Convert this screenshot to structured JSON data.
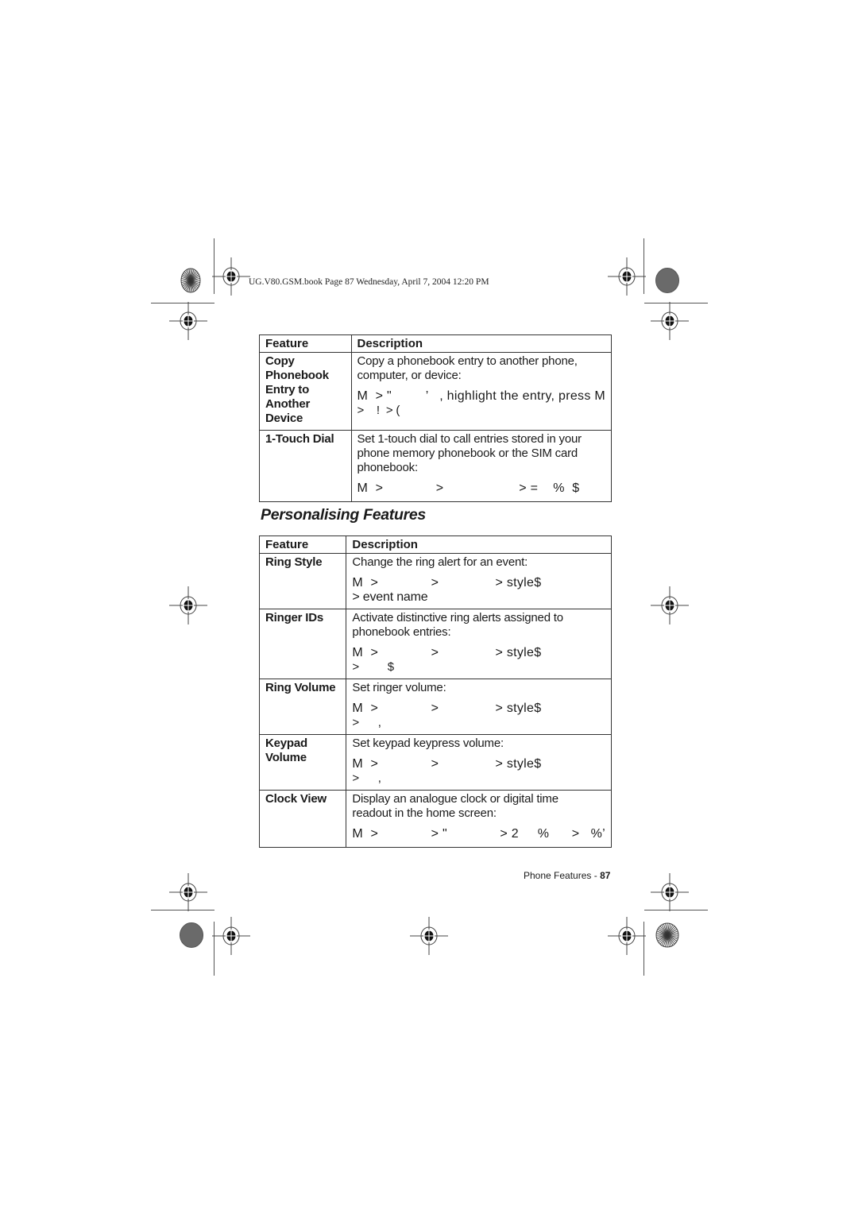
{
  "slug_line": "UG.V80.GSM.book  Page 87  Wednesday, April 7, 2004  12:20 PM",
  "table1": {
    "headers": [
      "Feature",
      "Description"
    ],
    "rows": [
      {
        "feature": [
          "Copy",
          "Phonebook",
          "Entry to Another",
          "Device"
        ],
        "description": [
          "Copy a phonebook entry to another phone,",
          "computer, or device:"
        ],
        "path": [
          "M  > \"         ’   , highlight the entry, press M",
          ">    !  > ("
        ]
      },
      {
        "feature": [
          "1-Touch Dial"
        ],
        "description": [
          "Set 1-touch dial to call entries stored in your",
          "phone memory phonebook or the SIM card",
          "phonebook:"
        ],
        "path": [
          "M  >              >                    > =    %  $"
        ]
      }
    ]
  },
  "section_title": "Personalising Features",
  "table2": {
    "headers": [
      "Feature",
      "Description"
    ],
    "rows": [
      {
        "feature": [
          "Ring Style"
        ],
        "description": [
          "Change the ring alert for an event:"
        ],
        "path": [
          "M  >              >               > style$",
          "> event name"
        ]
      },
      {
        "feature": [
          "Ringer IDs"
        ],
        "description": [
          "Activate distinctive ring alerts assigned to",
          "phonebook entries:"
        ],
        "path": [
          "M  >              >               > style$",
          ">         $"
        ]
      },
      {
        "feature": [
          "Ring Volume"
        ],
        "description": [
          "Set ringer volume:"
        ],
        "path": [
          "M  >              >               > style$",
          ">      ,"
        ]
      },
      {
        "feature": [
          "Keypad Volume"
        ],
        "description": [
          "Set keypad keypress volume:"
        ],
        "path": [
          "M  >              >               > style$",
          ">      ,"
        ]
      },
      {
        "feature": [
          "Clock View"
        ],
        "description": [
          "Display an analogue clock or digital time",
          "readout in the home screen:"
        ],
        "path": [
          "M  >              > \"              > 2     %      >   %’"
        ]
      }
    ]
  },
  "footer": {
    "section": "Phone Features - ",
    "page_number": "87"
  },
  "icons": {
    "registration_mark": "crosshair-registration-icon",
    "color_disc_striped": "striped-disc-icon",
    "color_disc_gray": "gray-disc-icon"
  }
}
